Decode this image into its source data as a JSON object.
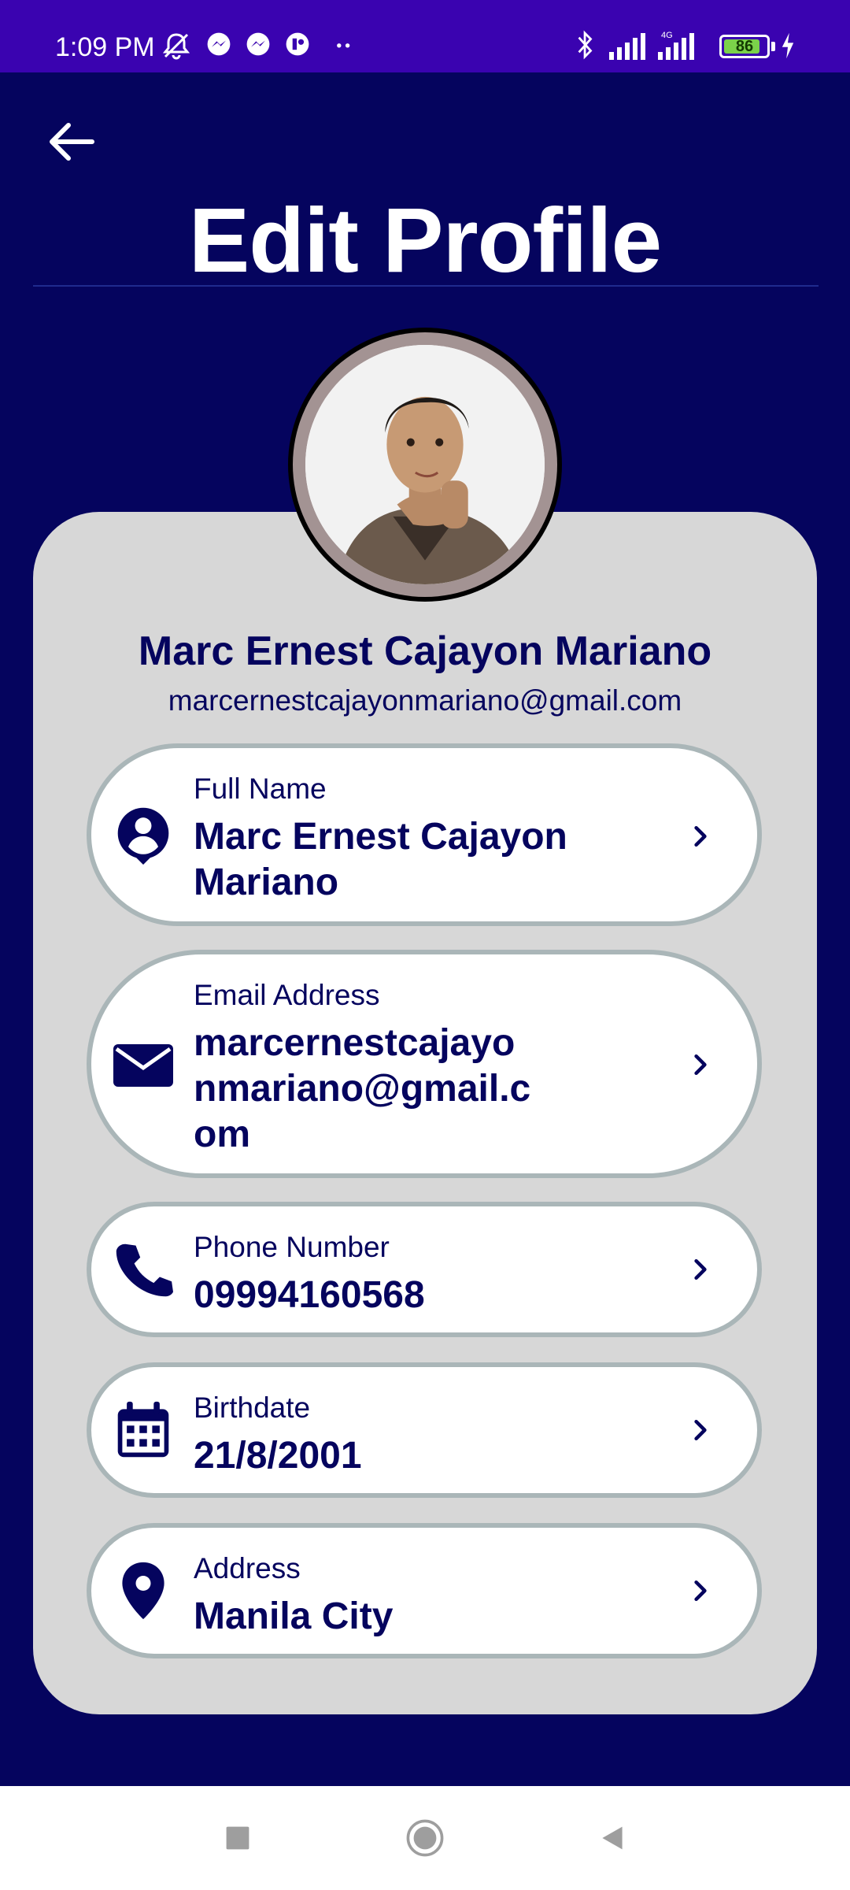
{
  "status_bar": {
    "time": "1:09 PM",
    "battery": "86",
    "battery_level": 0.86,
    "network": "4G",
    "icons": [
      "mute-alarm-icon",
      "messenger-icon",
      "messenger-icon",
      "app-notification-icon",
      "more-dots-icon",
      "bluetooth-icon",
      "signal-icon",
      "signal-4g-icon",
      "battery-icon",
      "charging-icon"
    ]
  },
  "header": {
    "title": "Edit Profile",
    "back_icon": "arrow-left-icon"
  },
  "profile": {
    "name": "Marc Ernest Cajayon Mariano",
    "email": "marcernestcajayonmariano@gmail.com"
  },
  "fields": {
    "full_name": {
      "label": "Full Name",
      "value": "Marc Ernest Cajayon Mariano",
      "icon": "account-pin-icon"
    },
    "email": {
      "label": "Email Address",
      "value": "marcernestcajayonmariano@gmail.com",
      "icon": "mail-icon"
    },
    "phone": {
      "label": "Phone Number",
      "value": "09994160568",
      "icon": "phone-icon"
    },
    "birthdate": {
      "label": "Birthdate",
      "value": "21/8/2001",
      "icon": "calendar-icon"
    },
    "address": {
      "label": "Address",
      "value": "Manila City",
      "icon": "location-pin-icon"
    }
  },
  "colors": {
    "background": "#05045e",
    "status_bar": "#3a03b0",
    "card": "#d7d7d7",
    "text_primary": "#05045e",
    "pill_border": "#aab6b8"
  },
  "nav_bar": {
    "icons": [
      "recents-square-icon",
      "home-circle-icon",
      "back-triangle-icon"
    ]
  }
}
